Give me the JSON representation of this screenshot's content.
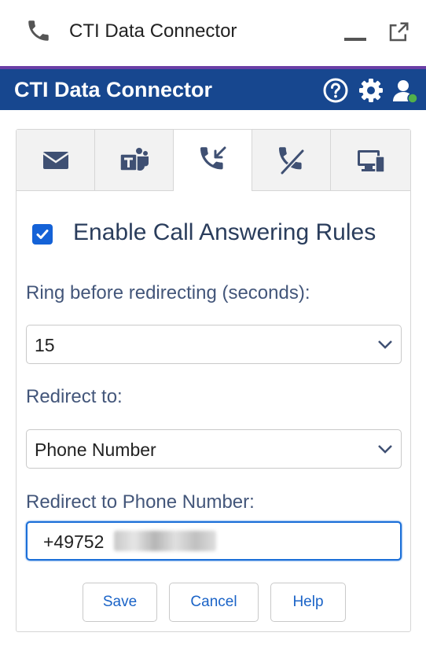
{
  "window": {
    "title": "CTI Data Connector",
    "icons": [
      "phone-icon",
      "minimize-icon",
      "popout-icon"
    ]
  },
  "header": {
    "title": "CTI Data Connector",
    "icons": [
      "help-icon",
      "gear-icon",
      "user-status-icon"
    ],
    "bar_color": "#17478f",
    "status_color": "#52b04a"
  },
  "tabs": [
    {
      "icon": "envelope-icon",
      "active": false
    },
    {
      "icon": "teams-icon",
      "active": false
    },
    {
      "icon": "incoming-call-icon",
      "active": true
    },
    {
      "icon": "missed-call-icon",
      "active": false
    },
    {
      "icon": "desktop-icon",
      "active": false
    }
  ],
  "form": {
    "enable_label": "Enable Call Answering Rules",
    "enable_checked": true,
    "ring_label": "Ring before redirecting (seconds):",
    "ring_value": "15",
    "redirect_label": "Redirect to:",
    "redirect_value": "Phone Number",
    "phone_label": "Redirect to Phone Number:",
    "phone_value": "+49752"
  },
  "buttons": {
    "save": "Save",
    "cancel": "Cancel",
    "help": "Help"
  },
  "accent_color": "#1462d7"
}
